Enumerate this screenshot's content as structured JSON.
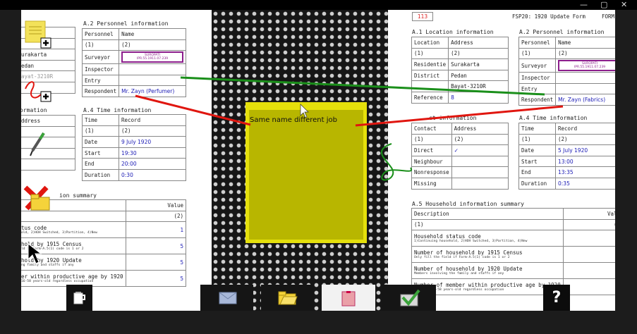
{
  "window": {
    "minimize": "—",
    "restore": "▢",
    "close": "✕"
  },
  "left": {
    "personnel": {
      "heading": "A.2 Personnel information",
      "col1": "Personnel",
      "col2": "Name",
      "n1": "(1)",
      "n2": "(2)",
      "rows": [
        "Surveyor",
        "Inspector",
        "Entry",
        "Respondent"
      ],
      "stamp1": "SUROPATI",
      "stamp2": "IPR.55.1911.07.239",
      "respondent": "Mr. Zayn (Perfumer)"
    },
    "location_partial": {
      "heading": "",
      "values": [
        "urakarta",
        "edan",
        "ayat-3210R"
      ]
    },
    "time": {
      "heading": "A.4 Time information",
      "col1": "Time",
      "col2": "Record",
      "n1": "(1)",
      "n2": "(2)",
      "rows": [
        "Date",
        "Start",
        "End",
        "Duration"
      ],
      "values": [
        "9 July 1920",
        "19:30",
        "20:00",
        "0:30"
      ]
    },
    "contact_partial": {
      "heading": "ormation",
      "first": "ddress"
    },
    "household": {
      "heading": "ion summary",
      "value_col": "Value",
      "n2": "(2)",
      "rows": [
        {
          "main": "tus code",
          "sub": "old, 2)HOH Switched, 3)Partition, 4)New",
          "value": "1"
        },
        {
          "main": "hold by 1915 Census",
          "sub": "ld if Form-A.5(1) code is 1 or 2",
          "value": "5"
        },
        {
          "main": "hold by 1920 Update",
          "sub": "ng family and staffs if any",
          "value": "5"
        },
        {
          "main": "er within productive age by 1920",
          "sub": "16-58 years-old regardless occupation",
          "value": "5"
        }
      ]
    }
  },
  "right": {
    "form_id": "113",
    "form_title": "FSP20: 1920 Update Form",
    "form_label": "FORM",
    "location": {
      "heading": "A.1 Location information",
      "col1": "Location",
      "col2": "Address",
      "n1": "(1)",
      "n2": "(2)",
      "rows": [
        {
          "label": "Residentie",
          "value": "Surakarta"
        },
        {
          "label": "District",
          "value": "Pedan"
        },
        {
          "label": "",
          "value": "Bayat-3210R"
        },
        {
          "label": "Reference",
          "value": "8"
        }
      ]
    },
    "personnel": {
      "heading": "A.2 Personnel information",
      "col1": "Personnel",
      "col2": "Name",
      "n1": "(1)",
      "n2": "(2)",
      "rows": [
        "Surveyor",
        "Inspector",
        "Entry",
        "Respondent"
      ],
      "stamp1": "SUROPATI",
      "stamp2": "IPR.55.1911.07.239",
      "respondent": "Mr. Zayn (Fabrics)"
    },
    "contact": {
      "heading": "ct information",
      "col1": "Contact",
      "col2": "Address",
      "n1": "(1)",
      "n2": "(2)",
      "rows": [
        "Direct",
        "Neighbour",
        "Nonresponse",
        "Missing"
      ],
      "check": "✓"
    },
    "time": {
      "heading": "A.4 Time information",
      "col1": "Time",
      "col2": "Record",
      "n1": "(1)",
      "n2": "(2)",
      "rows": [
        "Date",
        "Start",
        "End",
        "Duration"
      ],
      "values": [
        "5 July 1920",
        "13:00",
        "13:35",
        "0:35"
      ]
    },
    "household": {
      "heading": "A.5 Household information summary",
      "col1": "Description",
      "value_col": "Valu",
      "n1": "(1)",
      "n2": "(2",
      "rows": [
        {
          "main": "Household status code",
          "sub": "1)Continuing household, 2)HOH Switched, 3)Partition, 4)New"
        },
        {
          "main": "Number of household by 1915 Census",
          "sub": "Only fill the field if Form-A.5(1) code is 1 or 2"
        },
        {
          "main": "Number of household by 1920 Update",
          "sub": "Members involving the family and staffs if any"
        },
        {
          "main": "Number of member within productive age by 1920",
          "sub": "in range 16-58 years-old regardless occupation"
        }
      ]
    }
  },
  "note": {
    "text": "Same name different job"
  },
  "toolbar": {
    "help": "?"
  },
  "colors": {
    "note_border": "#e5e00b",
    "note_fill": "#b8b600",
    "red_line": "#e0160f",
    "green_line": "#1a8f1a"
  }
}
